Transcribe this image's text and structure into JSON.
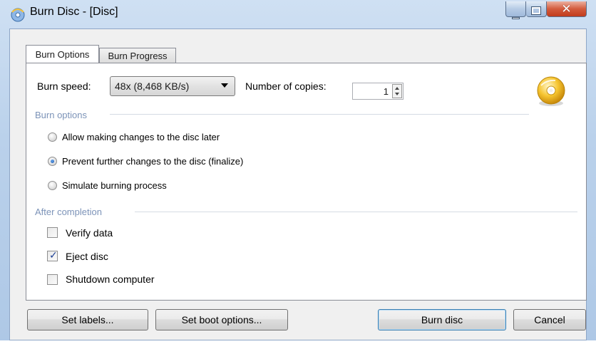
{
  "window": {
    "title": "Burn Disc - [Disc]"
  },
  "tabs": [
    {
      "label": "Burn Options",
      "active": true
    },
    {
      "label": "Burn Progress",
      "active": false
    }
  ],
  "burn_speed": {
    "label": "Burn speed:",
    "selected": "48x (8,468 KB/s)"
  },
  "copies": {
    "label": "Number of copies:",
    "value": "1"
  },
  "burn_options": {
    "title": "Burn options",
    "options": [
      {
        "label": "Allow making changes to the disc later",
        "checked": false
      },
      {
        "label": "Prevent further changes to the disc (finalize)",
        "checked": true
      },
      {
        "label": "Simulate burning process",
        "checked": false
      }
    ]
  },
  "after_completion": {
    "title": "After completion",
    "items": [
      {
        "label": "Verify data",
        "checked": false
      },
      {
        "label": "Eject disc",
        "checked": true
      },
      {
        "label": "Shutdown computer",
        "checked": false
      }
    ]
  },
  "buttons": {
    "set_labels": "Set labels...",
    "set_boot_options": "Set boot options...",
    "burn_disc": "Burn disc",
    "cancel": "Cancel"
  },
  "icons": {
    "app": "disc-burner-icon",
    "disc": "disc-icon"
  },
  "colors": {
    "group_title": "#7c93b8",
    "close_button": "#c13b1c",
    "radio_dot": "#1756b0"
  }
}
